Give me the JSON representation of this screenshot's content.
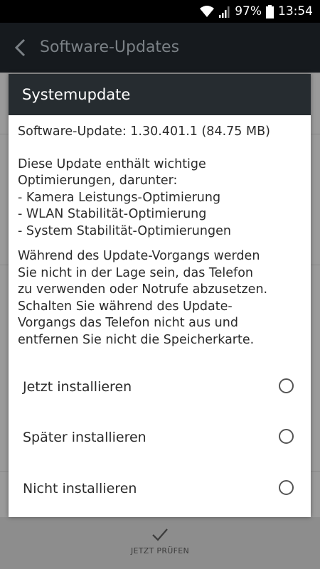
{
  "status_bar": {
    "battery_percent": "97%",
    "time": "13:54",
    "icons": [
      "wifi-icon",
      "signal-icon",
      "battery-icon"
    ]
  },
  "app_bar": {
    "back_icon": "chevron-left-icon",
    "title": "Software-Updates"
  },
  "dialog": {
    "title": "Systemupdate",
    "version_line": "Software-Update: 1.30.401.1 (84.75 MB)",
    "description_lines": [
      "Diese Update enthält wichtige",
      "Optimierungen, darunter:",
      "- Kamera Leistungs-Optimierung",
      "- WLAN Stabilität-Optimierung",
      "- System Stabilität-Optimierungen"
    ],
    "warning_lines": [
      "Während des Update-Vorgangs werden",
      "Sie nicht in der Lage sein, das Telefon",
      "zu verwenden oder Notrufe abzusetzen.",
      "Schalten Sie während des Update-",
      "Vorgangs das Telefon nicht aus und",
      "entfernen Sie nicht die Speicherkarte."
    ],
    "options": [
      {
        "label": "Jetzt installieren",
        "selected": false
      },
      {
        "label": "Später installieren",
        "selected": false
      },
      {
        "label": "Nicht installieren",
        "selected": false
      }
    ]
  },
  "bottom_bar": {
    "icon": "check-icon",
    "label": "JETZT PRÜFEN"
  },
  "colors": {
    "dialog_header": "#262c30",
    "app_bar": "#161a1e",
    "scrim": "#9a9a9a"
  }
}
